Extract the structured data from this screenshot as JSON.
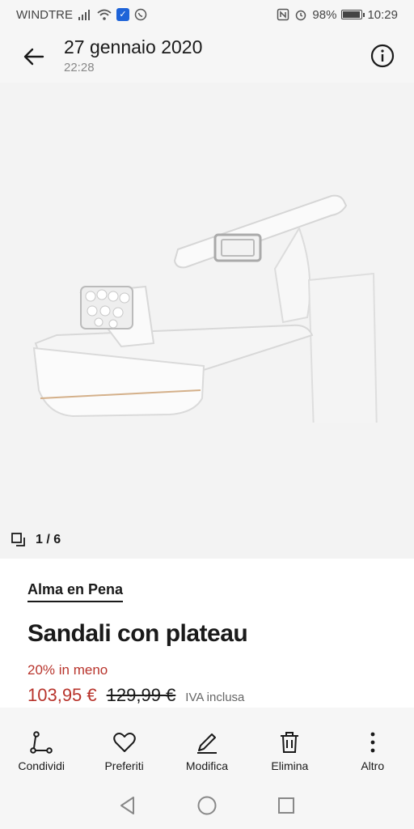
{
  "status_bar": {
    "carrier": "WINDTRE",
    "battery": "98%",
    "battery_level": 0.98,
    "time": "10:29",
    "icons": [
      "signal-icon",
      "wifi-icon",
      "shield-app-icon",
      "whatsapp-icon",
      "nfc-icon",
      "alarm-icon",
      "battery-icon"
    ]
  },
  "header": {
    "title": "27 gennaio 2020",
    "subtitle": "22:28",
    "back_icon": "back-arrow-icon",
    "info_icon": "info-icon"
  },
  "gallery": {
    "counter": "1 / 6",
    "counter_icon": "copy-icon"
  },
  "product": {
    "brand": "Alma en Pena",
    "name": "Sandali con plateau",
    "discount": "20% in meno",
    "price_now": "103,95 €",
    "price_old": "129,99 €",
    "vat": "IVA inclusa"
  },
  "actions": [
    {
      "label": "Condividi",
      "icon": "share-icon"
    },
    {
      "label": "Preferiti",
      "icon": "heart-icon"
    },
    {
      "label": "Modifica",
      "icon": "edit-icon"
    },
    {
      "label": "Elimina",
      "icon": "trash-icon"
    },
    {
      "label": "Altro",
      "icon": "more-icon"
    }
  ],
  "colors": {
    "accent_red": "#b8342c",
    "text": "#1a1a1a",
    "background": "#f6f6f6"
  }
}
